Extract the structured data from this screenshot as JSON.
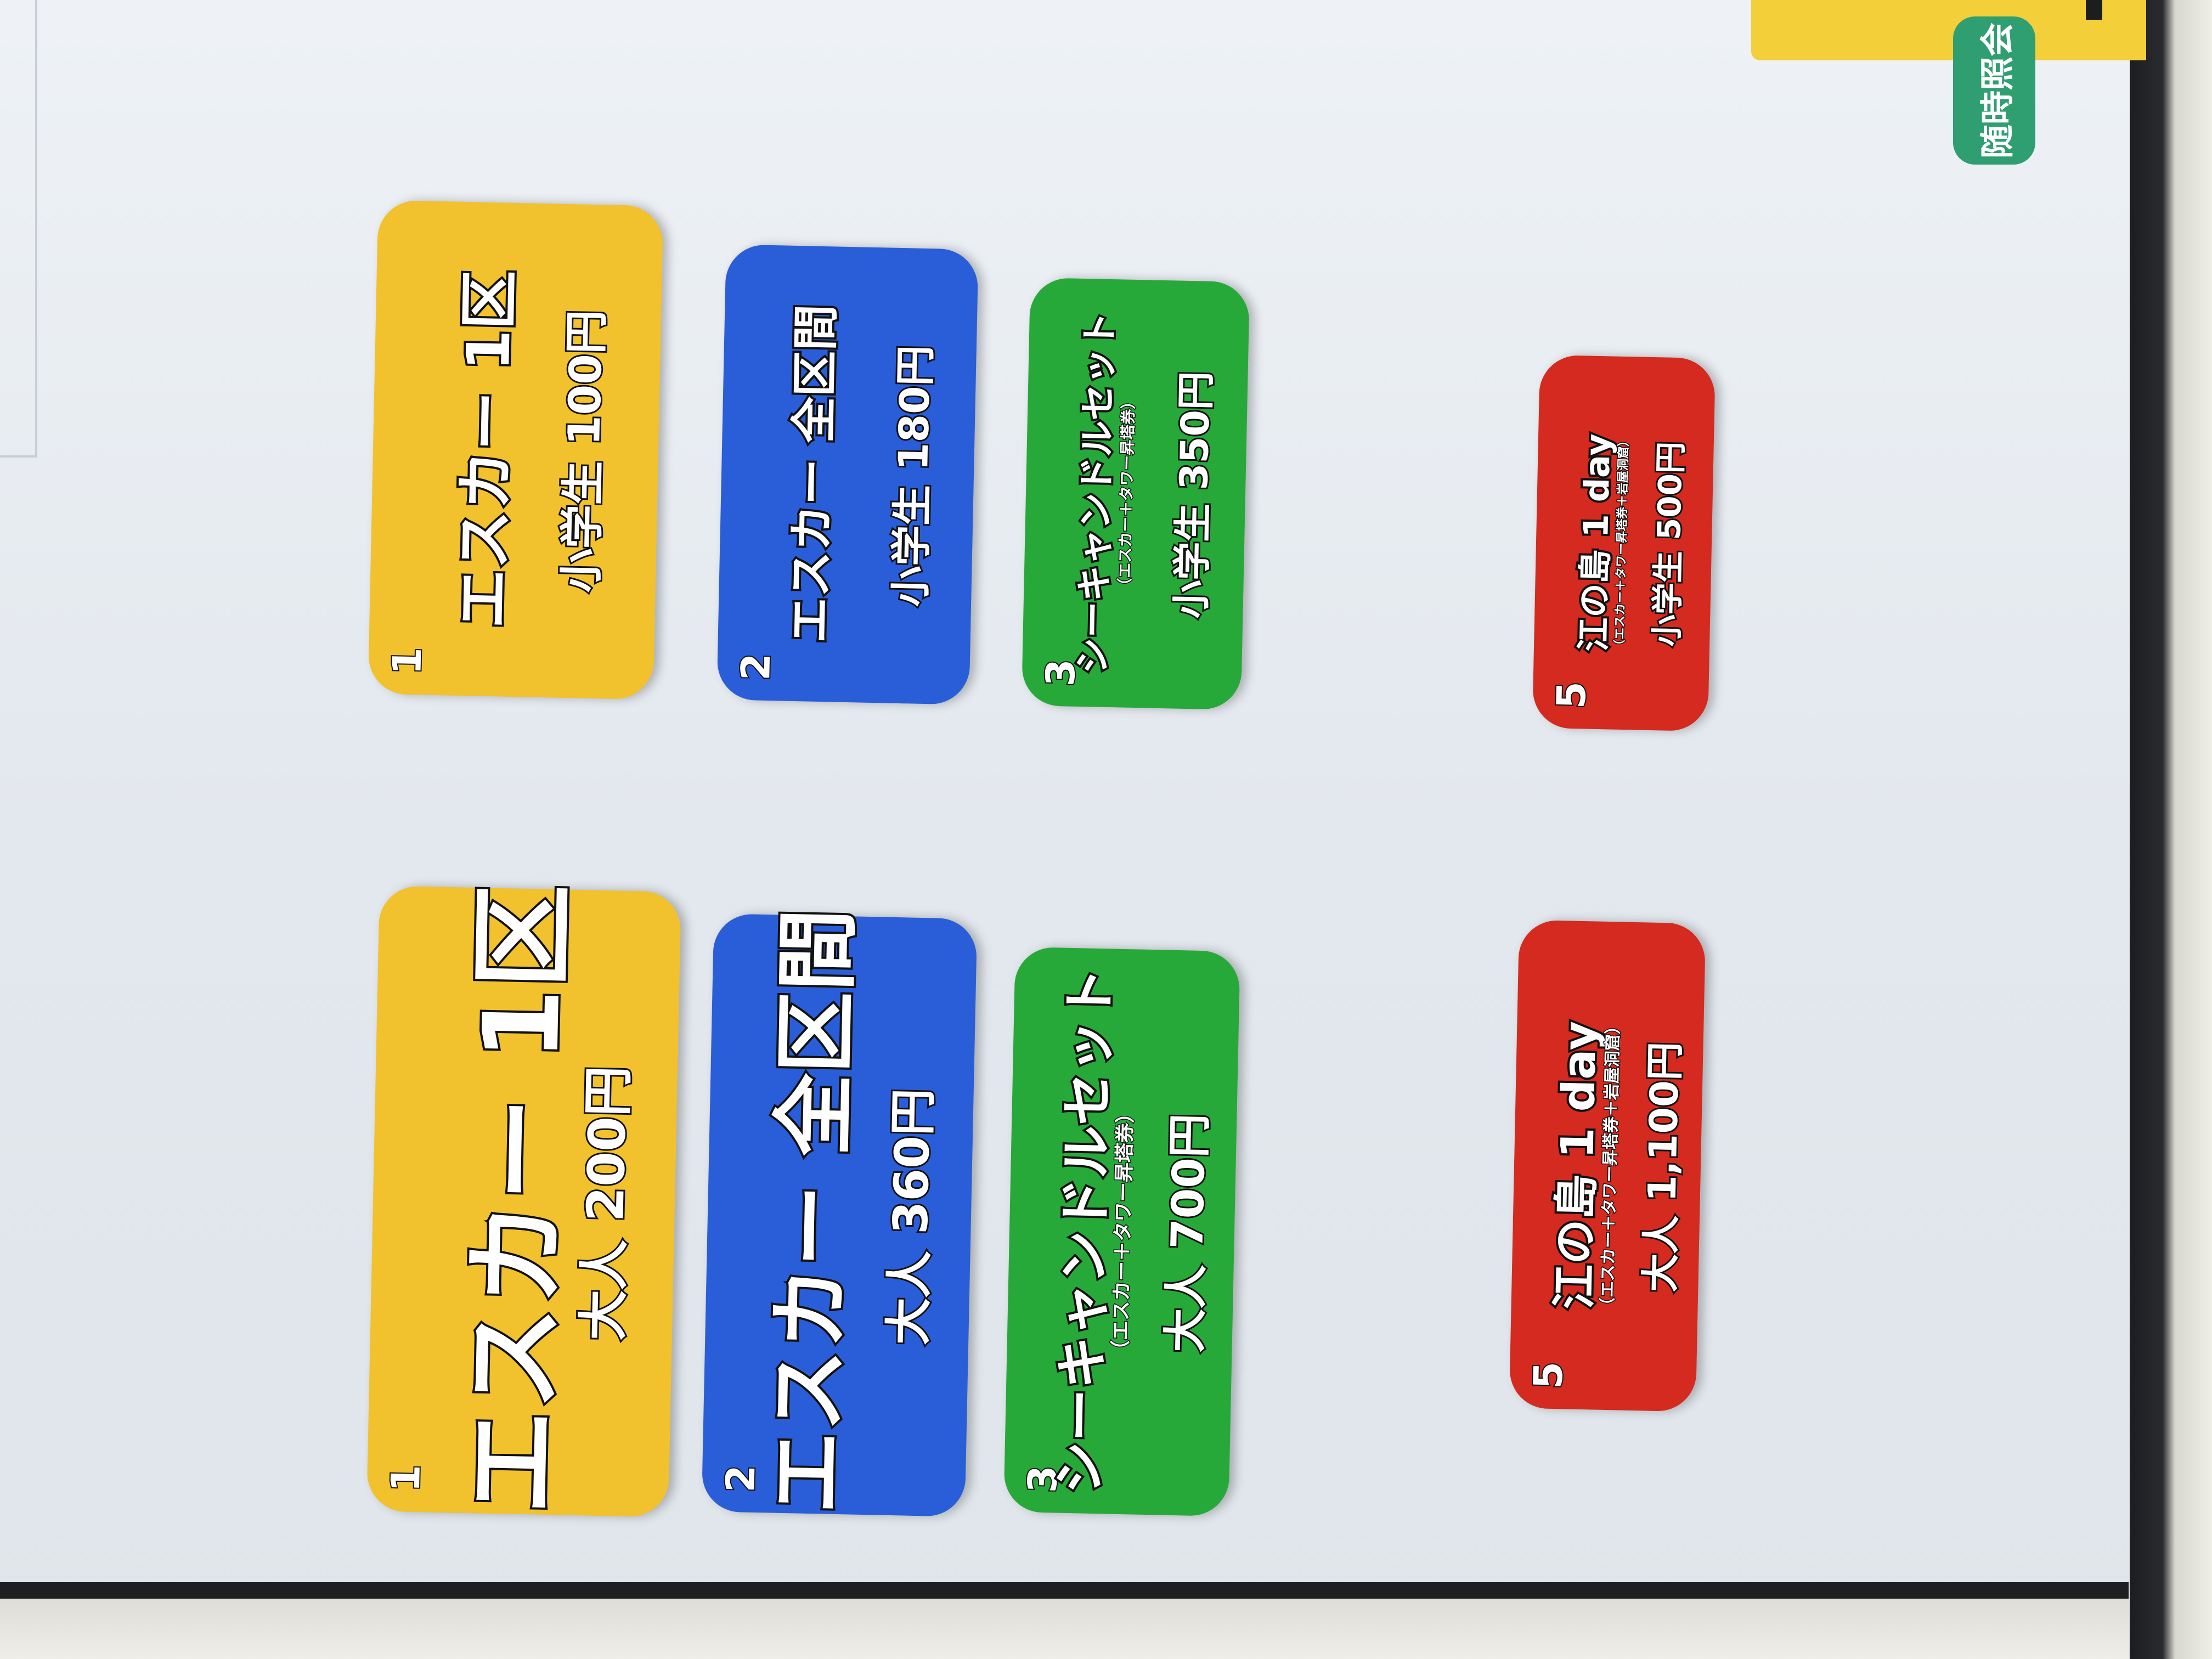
{
  "screen": {
    "inquiry_button": "随時照会",
    "tickets": [
      {
        "id": "adult-zone1",
        "number": "1",
        "title": "エスカー 1区",
        "subtitle": "",
        "fare": "大人 200円",
        "color": "#f2c12e"
      },
      {
        "id": "adult-all",
        "number": "2",
        "title": "エスカー 全区間",
        "subtitle": "",
        "fare": "大人 360円",
        "color": "#2a5ed8"
      },
      {
        "id": "adult-sea-candle",
        "number": "3",
        "title": "シーキャンドルセット",
        "subtitle": "（エスカー＋タワー昇塔券）",
        "fare": "大人 700円",
        "color": "#27a93a"
      },
      {
        "id": "adult-1day",
        "number": "5",
        "title": "江の島 1 day",
        "subtitle": "（エスカー＋タワー昇塔券＋岩屋洞窟）",
        "fare": "大人 1,100円",
        "color": "#d42a1f"
      },
      {
        "id": "child-zone1",
        "number": "1",
        "title": "エスカー 1区",
        "subtitle": "",
        "fare": "小学生 100円",
        "color": "#f2c12e"
      },
      {
        "id": "child-all",
        "number": "2",
        "title": "エスカー 全区間",
        "subtitle": "",
        "fare": "小学生 180円",
        "color": "#2a5ed8"
      },
      {
        "id": "child-sea-candle",
        "number": "3",
        "title": "シーキャンドルセット",
        "subtitle": "（エスカー＋タワー昇塔券）",
        "fare": "小学生 350円",
        "color": "#27a93a"
      },
      {
        "id": "child-1day",
        "number": "5",
        "title": "江の島 1 day",
        "subtitle": "（エスカー＋タワー昇塔券＋岩屋洞窟）",
        "fare": "小学生 500円",
        "color": "#d42a1f"
      }
    ]
  }
}
